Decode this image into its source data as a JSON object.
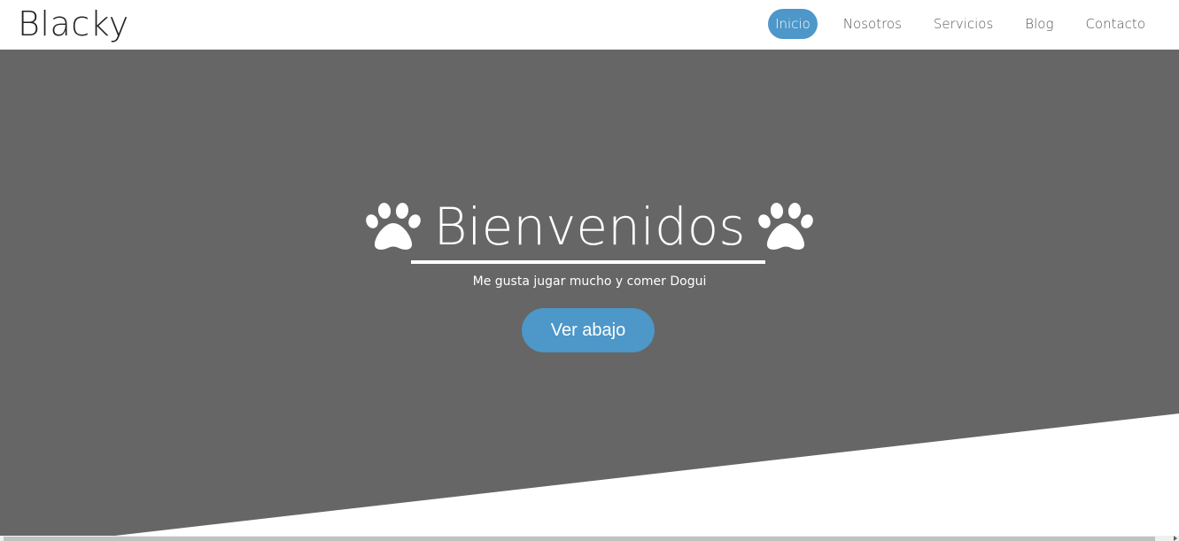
{
  "header": {
    "logo": "Blacky",
    "nav": [
      {
        "label": "Inicio",
        "active": true
      },
      {
        "label": "Nosotros",
        "active": false
      },
      {
        "label": "Servicios",
        "active": false
      },
      {
        "label": "Blog",
        "active": false
      },
      {
        "label": "Contacto",
        "active": false
      }
    ]
  },
  "hero": {
    "title": "Bienvenidos",
    "subtitle": "Me gusta jugar mucho y comer Dogui",
    "button_label": "Ver abajo",
    "left_icon": "paw-icon",
    "right_icon": "paw-icon"
  },
  "colors": {
    "hero_background": "#666666",
    "accent": "#4d97c9",
    "text_light": "#ffffff"
  }
}
